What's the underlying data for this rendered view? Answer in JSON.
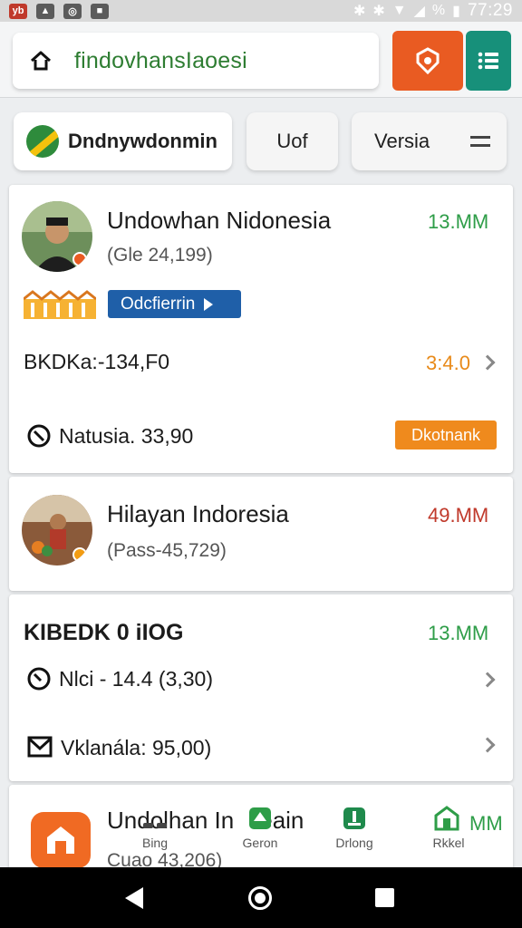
{
  "status_bar": {
    "time": "77:29",
    "battery": "%"
  },
  "browser": {
    "url": "findovhansIaoesi"
  },
  "chips": [
    {
      "label": "Dndnywdonmin"
    },
    {
      "label": "Uof"
    },
    {
      "label": "Versia"
    }
  ],
  "cards": [
    {
      "title": "Undowhan Nidonesia",
      "subtitle": "(Gle 24,199)",
      "metric": "13.MM",
      "tag": "Odcfierrin",
      "row1_text": "BKDKa:-134,F0",
      "row1_value": "3:4.0",
      "row2_text": "Natusia. 33,90",
      "row2_button": "Dkotnank"
    },
    {
      "title": "Hilayan Indoresia",
      "subtitle": "(Pass-45,729)",
      "metric": "49.MM"
    },
    {
      "title": "KIBEDK 0 iIOG",
      "metric": "13.MM",
      "row1_text": "Nlci - 14.4 (3,30)",
      "row2_text": "Vklanála: 95,00)"
    },
    {
      "title": "Undolhan In",
      "title_tail": "eain",
      "subtitle": "Cuao 43,206)",
      "metric": "MM"
    }
  ],
  "bottom_nav": [
    {
      "label": "Bing"
    },
    {
      "label": "Geron"
    },
    {
      "label": "Drlong"
    },
    {
      "label": "Rkkel"
    }
  ]
}
